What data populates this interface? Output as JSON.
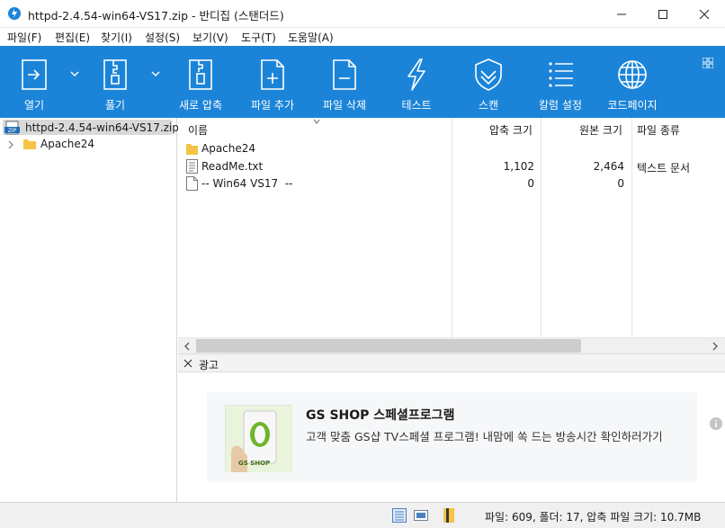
{
  "window": {
    "title": "httpd-2.4.54-win64-VS17.zip - 반디집 (스탠더드)"
  },
  "menu": [
    "파일(F)",
    "편집(E)",
    "찾기(I)",
    "설정(S)",
    "보기(V)",
    "도구(T)",
    "도움말(A)"
  ],
  "toolbar": {
    "buttons": [
      {
        "label": "열기",
        "icon": "open-icon"
      },
      {
        "label": "풀기",
        "icon": "extract-icon"
      },
      {
        "label": "새로 압축",
        "icon": "new-archive-icon"
      },
      {
        "label": "파일 추가",
        "icon": "add-file-icon"
      },
      {
        "label": "파일 삭제",
        "icon": "delete-file-icon"
      },
      {
        "label": "테스트",
        "icon": "test-icon"
      },
      {
        "label": "스캔",
        "icon": "scan-shield-icon"
      },
      {
        "label": "칼럼 설정",
        "icon": "column-settings-icon"
      },
      {
        "label": "코드페이지",
        "icon": "codepage-globe-icon"
      }
    ]
  },
  "tree": {
    "root": "httpd-2.4.54-win64-VS17.zip",
    "children": [
      "Apache24"
    ]
  },
  "filelist": {
    "columns": [
      "이름",
      "압축 크기",
      "원본 크기",
      "파일 종류"
    ],
    "rows": [
      {
        "name": "Apache24",
        "packed": "",
        "size": "",
        "type": "",
        "icon": "folder-icon"
      },
      {
        "name": "ReadMe.txt",
        "packed": "1,102",
        "size": "2,464",
        "type": "텍스트 문서",
        "icon": "text-file-icon"
      },
      {
        "name": "-- Win64 VS17  --",
        "packed": "0",
        "size": "0",
        "type": "",
        "icon": "blank-file-icon"
      }
    ]
  },
  "ad": {
    "bar_label": "광고",
    "title": "GS SHOP 스페셜프로그램",
    "description": "고객 맞춤 GS샵 TV스페셜 프로그램! 내맘에 쏙 드는 방송시간 확인하러가기",
    "logo_text": "GS SHOP"
  },
  "status": {
    "text": "파일: 609, 폴더: 17, 압축 파일 크기: 10.7MB"
  },
  "colors": {
    "toolbar": "#1b84d8",
    "selection": "#d9d9d9",
    "folder": "#f6c445"
  }
}
